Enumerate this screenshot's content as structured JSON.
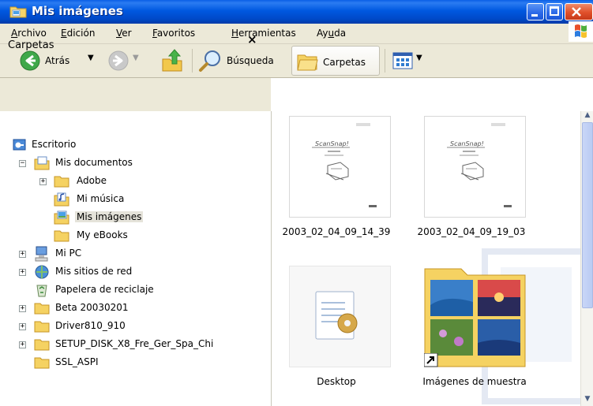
{
  "window": {
    "title": "Mis imágenes"
  },
  "menu": {
    "items": [
      {
        "label": "Archivo",
        "accel": "A",
        "rest": "rchivo"
      },
      {
        "label": "Edición",
        "accel": "E",
        "rest": "dición"
      },
      {
        "label": "Ver",
        "accel": "V",
        "rest": "er"
      },
      {
        "label": "Favoritos",
        "accel": "F",
        "rest": "avoritos"
      },
      {
        "label": "Herramientas",
        "accel": "H",
        "rest": "erramientas"
      },
      {
        "label": "Ayuda",
        "pre": "Ay",
        "accel": "u",
        "rest": "da"
      }
    ]
  },
  "toolbar": {
    "back_label": "Atrás",
    "search_label": "Búsqueda",
    "folders_label": "Carpetas"
  },
  "folders_pane": {
    "title": "Carpetas",
    "close_glyph": "×",
    "tree": [
      {
        "label": "Escritorio"
      },
      {
        "label": "Mis documentos"
      },
      {
        "label": "Adobe"
      },
      {
        "label": "Mi música"
      },
      {
        "label": "Mis imágenes"
      },
      {
        "label": "My eBooks"
      },
      {
        "label": "Mi PC"
      },
      {
        "label": "Mis sitios de red"
      },
      {
        "label": "Papelera de reciclaje"
      },
      {
        "label": "Beta 20030201"
      },
      {
        "label": "Driver810_910"
      },
      {
        "label": "SETUP_DISK_X8_Fre_Ger_Spa_Chi"
      },
      {
        "label": "SSL_ASPI"
      }
    ]
  },
  "files": [
    {
      "name": "2003_02_04_09_14_39",
      "type": "document-scan"
    },
    {
      "name": "2003_02_04_09_19_03",
      "type": "document-scan"
    },
    {
      "name": "Desktop",
      "type": "settings-file"
    },
    {
      "name": "Imágenes de muestra",
      "type": "shortcut-folder"
    }
  ],
  "colors": {
    "title_bar": "#0054e3",
    "chrome": "#ece9d8",
    "selection": "#e5e3da"
  }
}
